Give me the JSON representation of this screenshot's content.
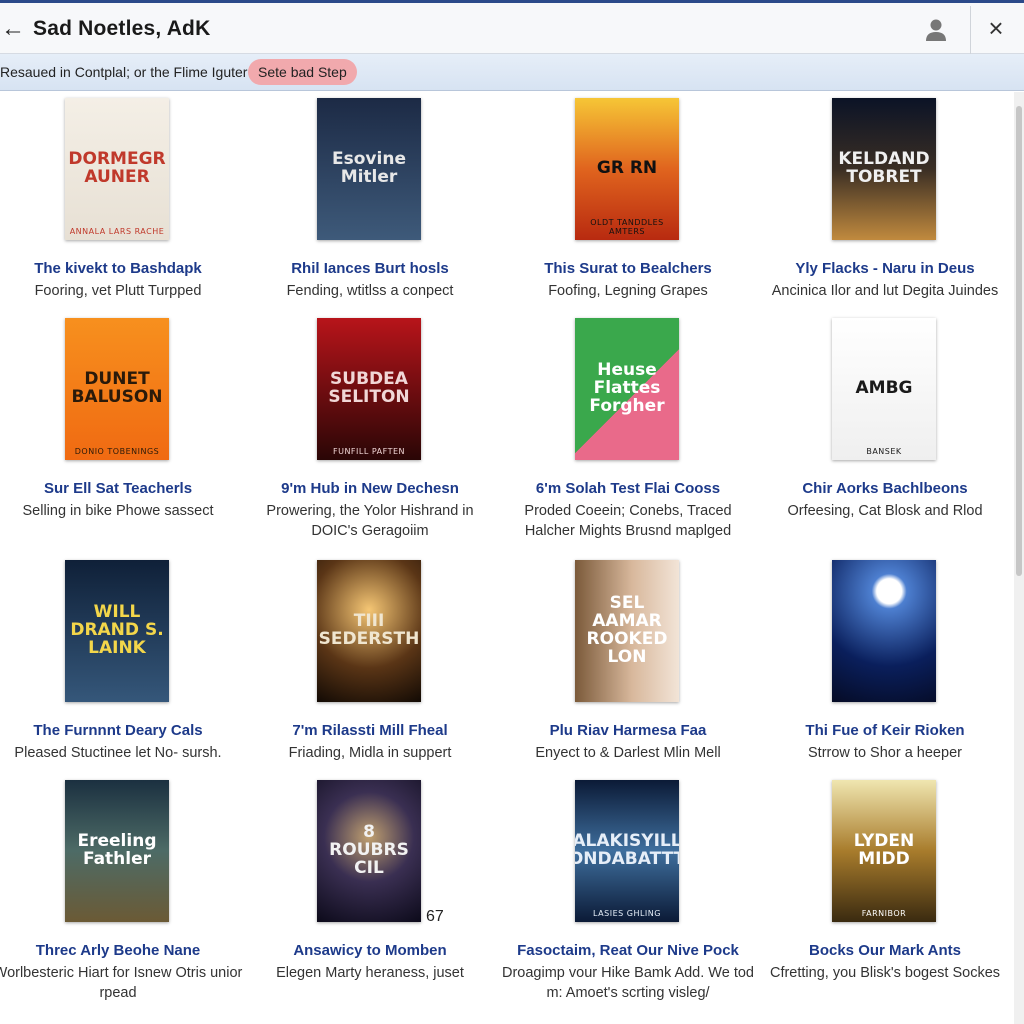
{
  "header": {
    "back_label": "←",
    "title": "Sad Noetles, AdK",
    "close_label": "×"
  },
  "subbar": {
    "text": "Resaued in Contplal; or the Flime Iguter",
    "pill_label": "Sete bad Step"
  },
  "books": [
    {
      "title": "The kivekt to Bashdapk",
      "desc": "Fooring, vet Plutt Turpped",
      "cover_text": "DORMEGR AUNER",
      "cover_sub": "ANNALA LARS RACHE",
      "bg": "linear-gradient(#f4efe6,#e7e0d4)",
      "fg": "#c0392b"
    },
    {
      "title": "Rhil Iances Burt hosls",
      "desc": "Fending, wtitlss a conpect",
      "cover_text": "Esovine Mitler",
      "cover_sub": "",
      "bg": "linear-gradient(#1c2a45,#3e5a7a)",
      "fg": "#e8e8e8"
    },
    {
      "title": "This Surat to Bealchers",
      "desc": "Foofing, Legning Grapes",
      "cover_text": "GR RN",
      "cover_sub": "OLDT TANDDLES AMTERS",
      "bg": "linear-gradient(#f6c636,#e0641e,#b82a10)",
      "fg": "#111111"
    },
    {
      "title": "Yly Flacks - Naru in Deus",
      "desc": "Ancinica Ilor and lut Degita Juindes",
      "cover_text": "KELDAND TOBRET",
      "cover_sub": "",
      "bg": "linear-gradient(#0b1326,#3a2e24,#c18a3e)",
      "fg": "#f0f0f0"
    },
    {
      "title": "Sur Ell Sat Teacherls",
      "desc": "Selling in bike Phowe sassect",
      "cover_text": "DUNET BALUSON",
      "cover_sub": "DONIO TOBENINGS",
      "bg": "linear-gradient(#f7901e,#f06a12)",
      "fg": "#2a1a0a"
    },
    {
      "title": "9'm Hub in New Dechesn",
      "desc": "Prowering, the Yolor Hishrand in DOIC's Geragoiim",
      "cover_text": "SUBDEA SELITON",
      "cover_sub": "FUNFILL PAFTEN",
      "bg": "linear-gradient(#b8141a,#2a0606)",
      "fg": "#f1d7d7"
    },
    {
      "title": "6'm Solah Test Flai Cooss",
      "desc": "Proded Coeein; Conebs, Traced Halcher Mights Brusnd maplged",
      "cover_text": "Heuse Flattes Forgher",
      "cover_sub": "",
      "bg": "linear-gradient(135deg,#3aa84c 0 55%,#e96a8a 55% 100%)",
      "fg": "#ffffff"
    },
    {
      "title": "Chir Aorks Bachlbeons",
      "desc": "Orfeesing, Cat Blosk and Rlod",
      "cover_text": "AMBG",
      "cover_sub": "BANSEK",
      "bg": "linear-gradient(#ffffff,#efefef)",
      "fg": "#1a1a1a"
    },
    {
      "title": "The Furnnnt Deary Cals",
      "desc": "Pleased Stuctinee let No- sursh.",
      "cover_text": "WILL DRAND S. LAINK",
      "cover_sub": "",
      "bg": "linear-gradient(#0f2038,#35577a)",
      "fg": "#f3d64a"
    },
    {
      "title": "7'm Rilassti Mill Fheal",
      "desc": "Friading, Midla in suppert",
      "cover_text": "TIII SEDERSTH",
      "cover_sub": "",
      "bg": "radial-gradient(circle at 50% 35%,#f5c674,#5a3516 55%,#120a04)",
      "fg": "#f0e6d0"
    },
    {
      "title": "Plu Riav Harmesa Faa",
      "desc": "Enyect to & Darlest Mlin Mell",
      "cover_text": "SEL AAMAR ROOKED LON",
      "cover_sub": "",
      "bg": "linear-gradient(90deg,#7b5a3a,#d8b89c 55%,#f2e4d7)",
      "fg": "#ffffff"
    },
    {
      "title": "Thi Fue of Keir Rioken",
      "desc": "Strrow to Shor a heeper",
      "cover_text": "",
      "cover_sub": "",
      "bg": "radial-gradient(circle at 55% 22%,#ffffff 0 10%,#4d7fd0 14%,#0a1f5c 60%,#050b25)",
      "fg": "#ffffff"
    },
    {
      "title": "Threc Arly Beohe Nane",
      "desc": "Worlbesteric Hiart for Isnew Otris unior rpead",
      "cover_text": "Ereeling Fathler",
      "cover_sub": "",
      "bg": "linear-gradient(#1b3040,#4d6b66,#6b5a35)",
      "fg": "#ffffff"
    },
    {
      "title": "Ansawicy to Momben",
      "desc": "Elegen Marty heraness, juset",
      "cover_text": "8 ROUBRS CIL",
      "cover_sub": "",
      "bg": "radial-gradient(circle at 50% 40%,#c0a070,#3a2f52 45%,#0c0a1a)",
      "fg": "#f2f2f2"
    },
    {
      "title": "Fasoctaim, Reat Our Nive Pock",
      "desc": "Droagimp vour Hike Bamk Add. We tod m: Amoet's scrting visleg/",
      "cover_text": "ALAKISYILL ONDABATTT",
      "cover_sub": "LASIES GHLING",
      "bg": "linear-gradient(#0b1a36,#3f6f9e,#0b1a36)",
      "fg": "#e6eef8"
    },
    {
      "title": "Bocks Our Mark Ants",
      "desc": "Cfretting, you Blisk's bogest Sockes",
      "cover_text": "LYDEN MIDD",
      "cover_sub": "FARNIBOR",
      "bg": "linear-gradient(#f0e6b0,#a87c2c,#3a2a10)",
      "fg": "#ffffff"
    }
  ],
  "mark": "67"
}
